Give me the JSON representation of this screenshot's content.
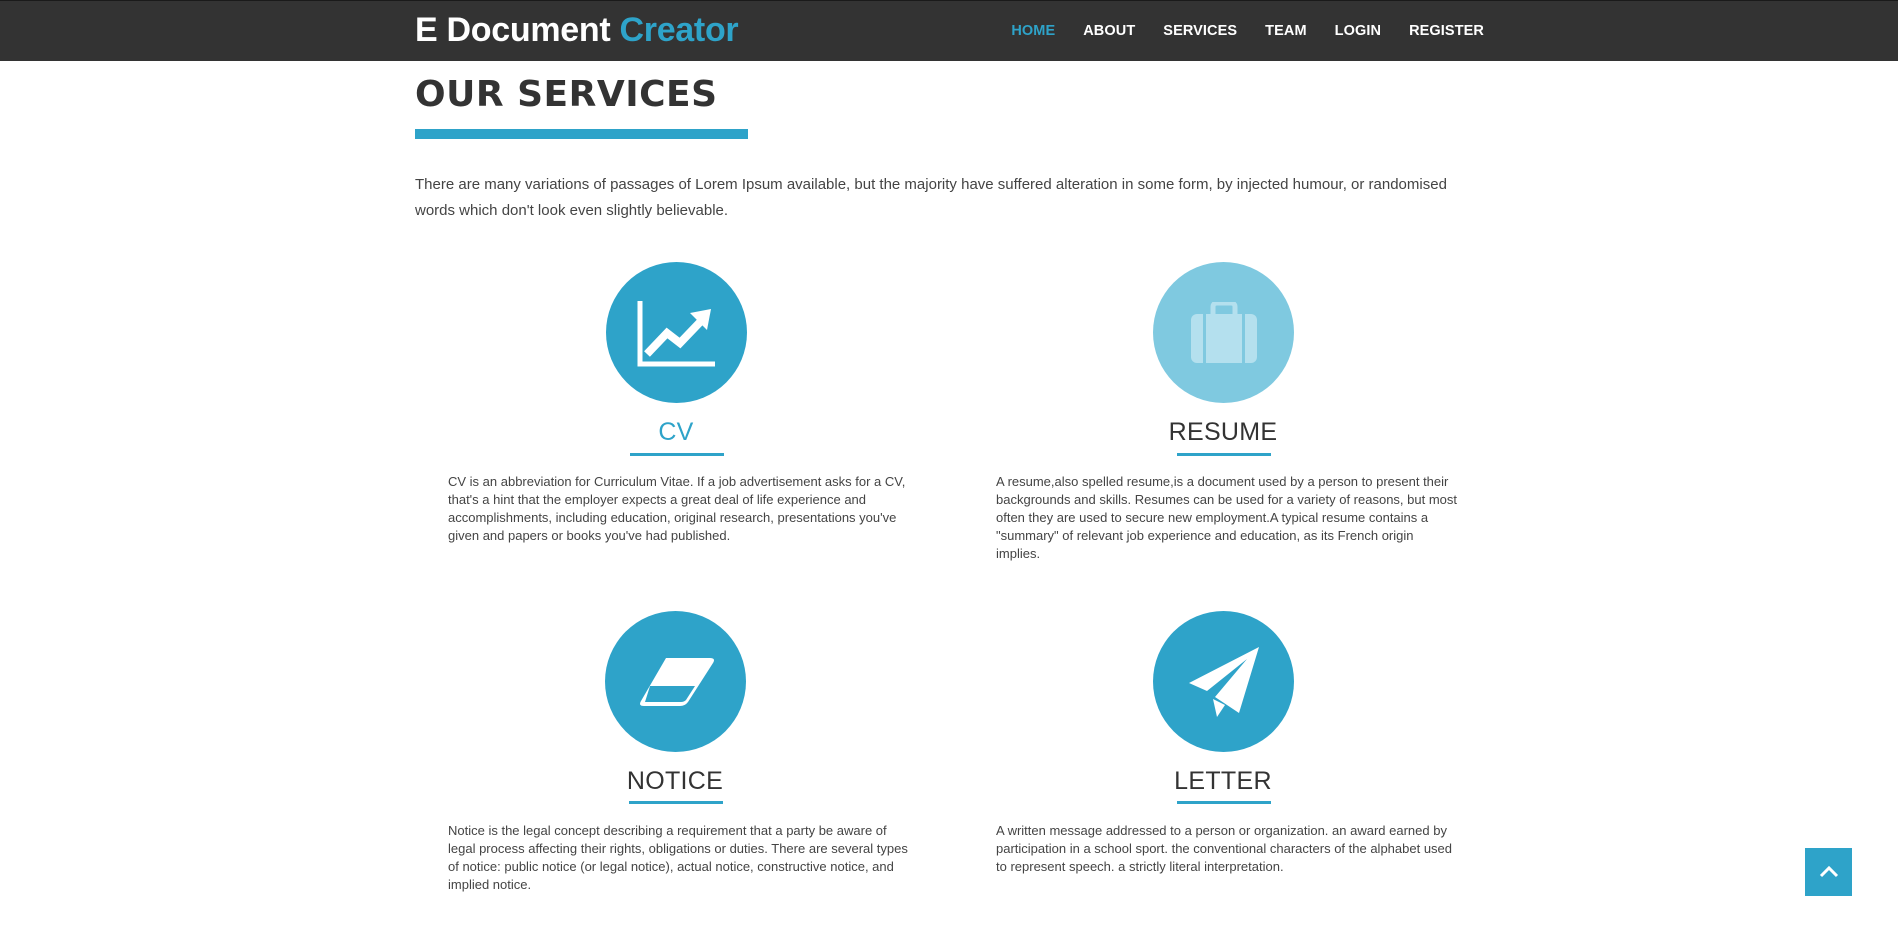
{
  "brand": {
    "part1": "E Document",
    "part2": "Creator"
  },
  "nav": {
    "items": [
      {
        "label": "HOME",
        "active": true
      },
      {
        "label": "ABOUT"
      },
      {
        "label": "SERVICES"
      },
      {
        "label": "TEAM"
      },
      {
        "label": "LOGIN"
      },
      {
        "label": "REGISTER"
      }
    ]
  },
  "section": {
    "title": "OUR SERVICES",
    "intro": "There are many variations of passages of Lorem Ipsum available, but the majority have suffered alteration in some form, by injected humour, or randomised words which don't look even slightly believable."
  },
  "services": [
    {
      "icon": "line-chart-icon",
      "title": "CV",
      "text": "CV is an abbreviation for Curriculum Vitae. If a job advertisement asks for a CV, that's a hint that the employer expects a great deal of life experience and accomplishments, including education, original research, presentations you've given and papers or books you've had published."
    },
    {
      "icon": "briefcase-icon",
      "title": "RESUME",
      "text": "A resume,also spelled resume,is a document used by a person to present their backgrounds and skills. Resumes can be used for a variety of reasons, but most often they are used to secure new employment.A typical resume contains a \"summary\" of relevant job experience and education, as its French origin implies."
    },
    {
      "icon": "eraser-icon",
      "title": "NOTICE",
      "text": "Notice is the legal concept describing a requirement that a party be aware of legal process affecting their rights, obligations or duties. There are several types of notice: public notice (or legal notice), actual notice, constructive notice, and implied notice."
    },
    {
      "icon": "paper-plane-icon",
      "title": "LETTER",
      "text": "A written message addressed to a person or organization. an award earned by participation in a school sport. the conventional characters of the alphabet used to represent speech. a strictly literal interpretation."
    }
  ],
  "colors": {
    "accent": "#2ea3c9",
    "accent_light": "#7fc9e0",
    "navbar": "#333333"
  },
  "scroll_top": {
    "icon": "chevron-up-icon"
  }
}
